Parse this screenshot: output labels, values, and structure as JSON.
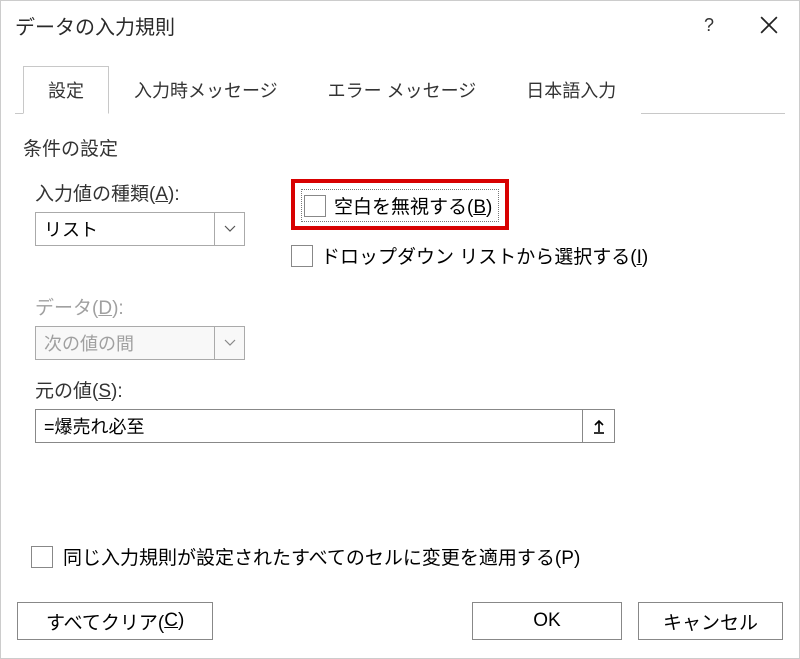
{
  "title": "データの入力規則",
  "tabs": [
    "設定",
    "入力時メッセージ",
    "エラー メッセージ",
    "日本語入力"
  ],
  "section": "条件の設定",
  "fields": {
    "allow_label_pre": "入力値の種類(",
    "allow_key": "A",
    "allow_label_post": "):",
    "allow_value": "リスト",
    "data_label_pre": "データ(",
    "data_key": "D",
    "data_label_post": "):",
    "data_value": "次の値の間",
    "source_label_pre": "元の値(",
    "source_key": "S",
    "source_label_post": "):",
    "source_value": "=爆売れ必至"
  },
  "checks": {
    "ignore_blank_pre": "空白を無視する(",
    "ignore_blank_key": "B",
    "ignore_blank_post": ")",
    "dropdown_pre": "ドロップダウン リストから選択する(",
    "dropdown_key": "I",
    "dropdown_post": ")",
    "apply_all_pre": "同じ入力規則が設定されたすべてのセルに変更を適用する(",
    "apply_all_key": "P",
    "apply_all_post": ")"
  },
  "buttons": {
    "clear_pre": "すべてクリア(",
    "clear_key": "C",
    "clear_post": ")",
    "ok": "OK",
    "cancel": "キャンセル"
  }
}
